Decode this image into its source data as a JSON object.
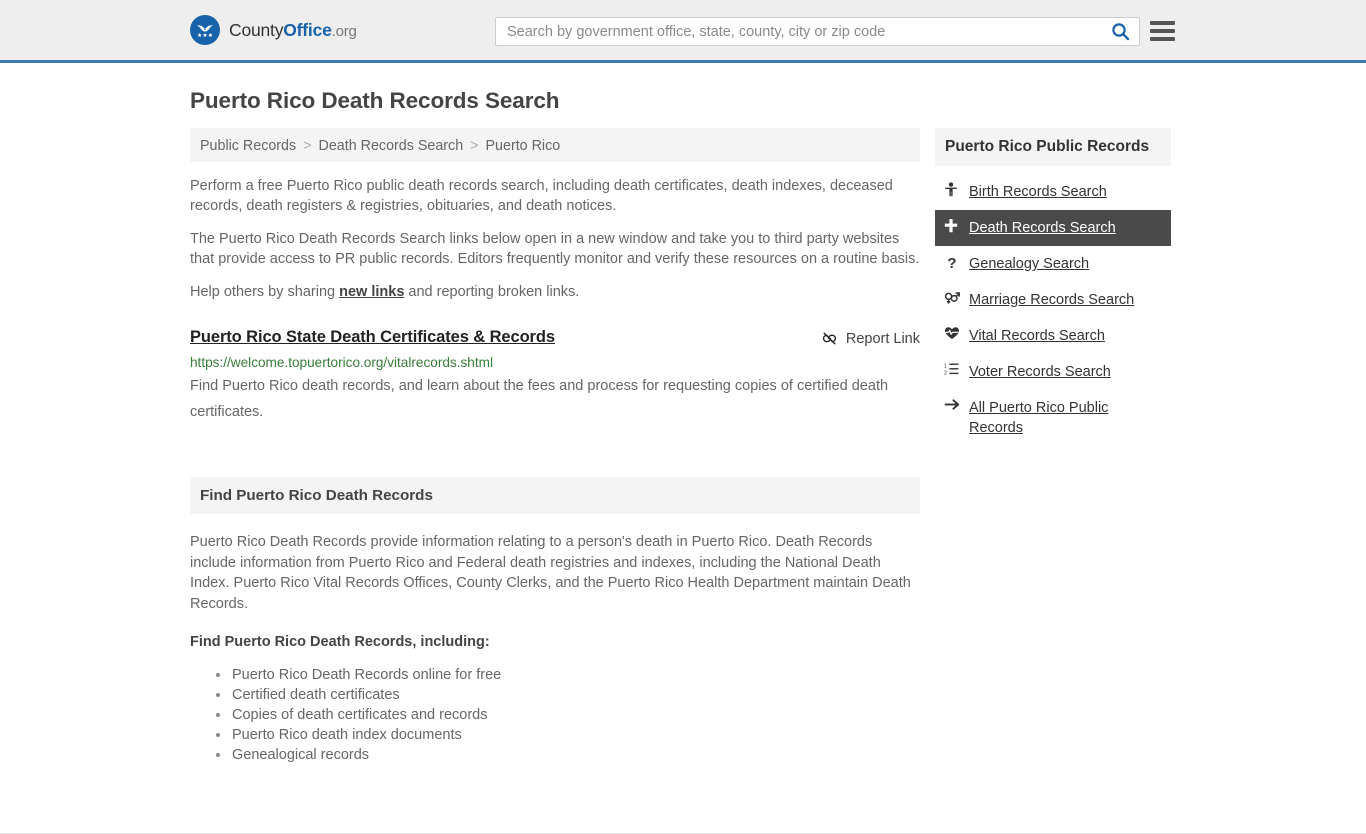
{
  "header": {
    "brand": {
      "part1": "County",
      "part2": "Office",
      "part3": ".org"
    },
    "search": {
      "placeholder": "Search by government office, state, county, city or zip code",
      "value": "",
      "icon": "search-icon"
    },
    "menu_icon": "hamburger-menu-icon",
    "accent_color": "#3a7ab5",
    "background_color": "#eeeeee"
  },
  "page": {
    "title": "Puerto Rico Death Records Search"
  },
  "breadcrumb": {
    "items": [
      {
        "label": "Public Records"
      },
      {
        "label": "Death Records Search"
      },
      {
        "label": "Puerto Rico"
      }
    ],
    "separator": ">"
  },
  "intro": {
    "p1": "Perform a free Puerto Rico public death records search, including death certificates, death indexes, deceased records, death registers & registries, obituaries, and death notices.",
    "p2": "The Puerto Rico Death Records Search links below open in a new window and take you to third party websites that provide access to PR public records. Editors frequently monitor and verify these resources on a routine basis.",
    "p3_before": "Help others by sharing ",
    "p3_link": "new links",
    "p3_after": " and reporting broken links."
  },
  "result": {
    "title": "Puerto Rico State Death Certificates & Records",
    "url": "https://welcome.topuertorico.org/vitalrecords.shtml",
    "description": "Find Puerto Rico death records, and learn about the fees and process for requesting copies of certified death certificates.",
    "report_label": "Report Link",
    "report_icon": "broken-link-icon",
    "url_color": "#3a7d3a"
  },
  "section": {
    "heading": "Find Puerto Rico Death Records",
    "paragraph": "Puerto Rico Death Records provide information relating to a person's death in Puerto Rico. Death Records include information from Puerto Rico and Federal death registries and indexes, including the National Death Index. Puerto Rico Vital Records Offices, County Clerks, and the Puerto Rico Health Department maintain Death Records.",
    "list_heading": "Find Puerto Rico Death Records, including:",
    "items": [
      "Puerto Rico Death Records online for free",
      "Certified death certificates",
      "Copies of death certificates and records",
      "Puerto Rico death index documents",
      "Genealogical records"
    ]
  },
  "sidebar": {
    "heading": "Puerto Rico Public Records",
    "active_background": "#4a4a4a",
    "items": [
      {
        "label": "Birth Records Search",
        "icon": "baby-icon",
        "glyph": "\u0000",
        "active": false
      },
      {
        "label": "Death Records Search",
        "icon": "cross-plus-icon",
        "glyph": "\u0000",
        "active": true
      },
      {
        "label": "Genealogy Search",
        "icon": "question-mark-icon",
        "glyph": "?",
        "active": false
      },
      {
        "label": "Marriage Records Search",
        "icon": "male-female-symbol-icon",
        "glyph": "\u0000",
        "active": false
      },
      {
        "label": "Vital Records Search",
        "icon": "heartbeat-icon",
        "glyph": "\u0000",
        "active": false
      },
      {
        "label": "Voter Records Search",
        "icon": "ordered-list-icon",
        "glyph": "\u0000",
        "active": false
      },
      {
        "label": "All Puerto Rico Public Records",
        "icon": "arrow-right-icon",
        "glyph": "→",
        "active": false
      }
    ]
  }
}
